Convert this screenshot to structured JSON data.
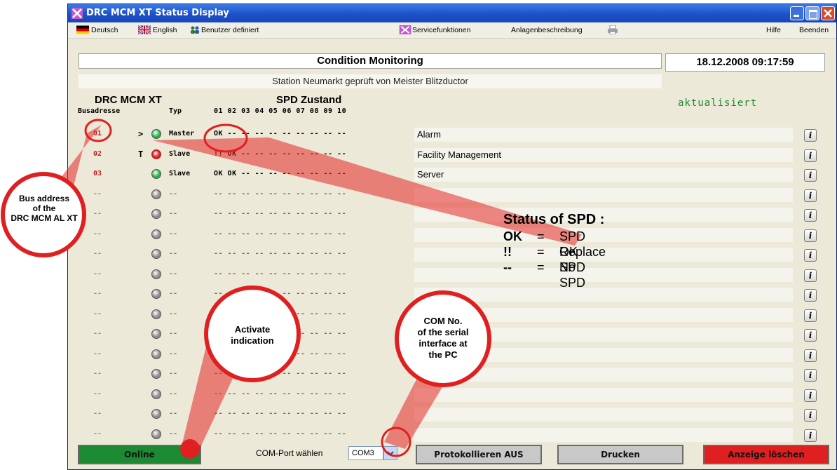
{
  "window": {
    "title": "DRC MCM XT Status Display"
  },
  "menu": {
    "deutsch": "Deutsch",
    "english": "English",
    "benutzer": "Benutzer definiert",
    "service": "Servicefunktionen",
    "anlagen": "Anlagenbeschreibung",
    "hilfe": "Hilfe",
    "beenden": "Beenden"
  },
  "header": {
    "title": "Condition Monitoring",
    "datetime": "18.12.2008  09:17:59",
    "subtitle": "Station Neumarkt geprüft von Meister Blitzductor",
    "status": "aktualisiert"
  },
  "columns": {
    "device": "DRC MCM XT",
    "spd": "SPD Zustand",
    "busadresse": "Busadresse",
    "typ": "Typ",
    "slots": "01 02 03 04 05 06 07 08 09 10"
  },
  "rows": [
    {
      "addr": "01",
      "mark": ">",
      "led": "green",
      "typ": "Master",
      "slots": "OK -- -- -- -- -- -- -- -- --",
      "desc": "Alarm"
    },
    {
      "addr": "02",
      "mark": "T",
      "led": "red",
      "typ": "Slave",
      "slots": "!! OK -- -- -- -- -- -- -- --",
      "desc": "Facility Management"
    },
    {
      "addr": "03",
      "mark": "",
      "led": "green",
      "typ": "Slave",
      "slots": "OK OK -- -- -- -- -- -- -- --",
      "desc": "Server"
    },
    {
      "addr": "--",
      "mark": "",
      "led": "grey",
      "typ": "--",
      "slots": "-- -- -- -- -- -- -- -- -- --",
      "desc": ""
    },
    {
      "addr": "--",
      "mark": "",
      "led": "grey",
      "typ": "--",
      "slots": "-- -- -- -- -- -- -- -- -- --",
      "desc": ""
    },
    {
      "addr": "--",
      "mark": "",
      "led": "grey",
      "typ": "--",
      "slots": "-- -- -- -- -- -- -- -- -- --",
      "desc": ""
    },
    {
      "addr": "--",
      "mark": "",
      "led": "grey",
      "typ": "--",
      "slots": "-- -- -- -- -- -- -- -- -- --",
      "desc": ""
    },
    {
      "addr": "--",
      "mark": "",
      "led": "grey",
      "typ": "--",
      "slots": "-- -- -- -- -- -- -- -- -- --",
      "desc": ""
    },
    {
      "addr": "--",
      "mark": "",
      "led": "grey",
      "typ": "--",
      "slots": "-- -- -- -- -- -- -- -- -- --",
      "desc": ""
    },
    {
      "addr": "--",
      "mark": "",
      "led": "grey",
      "typ": "--",
      "slots": "-- -- -- -- -- -- -- -- -- --",
      "desc": ""
    },
    {
      "addr": "--",
      "mark": "",
      "led": "grey",
      "typ": "--",
      "slots": "-- -- -- -- -- -- -- -- -- --",
      "desc": ""
    },
    {
      "addr": "--",
      "mark": "",
      "led": "grey",
      "typ": "--",
      "slots": "-- -- -- -- -- -- -- -- -- --",
      "desc": ""
    },
    {
      "addr": "--",
      "mark": "",
      "led": "grey",
      "typ": "--",
      "slots": "-- -- -- -- -- -- -- -- -- --",
      "desc": ""
    },
    {
      "addr": "--",
      "mark": "",
      "led": "grey",
      "typ": "--",
      "slots": "-- -- -- -- -- -- -- -- -- --",
      "desc": ""
    },
    {
      "addr": "--",
      "mark": "",
      "led": "grey",
      "typ": "--",
      "slots": "-- -- -- -- -- -- -- -- -- --",
      "desc": ""
    },
    {
      "addr": "--",
      "mark": "",
      "led": "grey",
      "typ": "--",
      "slots": "-- -- -- -- -- -- -- -- -- --",
      "desc": ""
    }
  ],
  "info_label": "i",
  "bottom": {
    "online": "Online",
    "com_label": "COM-Port wählen",
    "com_value": "COM3",
    "protokoll": "Protokollieren AUS",
    "drucken": "Drucken",
    "anzeige": "Anzeige löschen"
  },
  "annotations": {
    "bus_l1": "Bus address",
    "bus_l2": "of the",
    "bus_l3": "DRC MCM AL XT",
    "act_l1": "Activate",
    "act_l2": "indication",
    "com_l1": "COM No.",
    "com_l2": "of the serial",
    "com_l3": "interface at",
    "com_l4": "the PC",
    "legend_title": "Status of SPD :",
    "legend": [
      {
        "sym": "OK",
        "eq": "=",
        "text": "SPD OK"
      },
      {
        "sym": "!!",
        "eq": "=",
        "text": "Replace SPD"
      },
      {
        "sym": "--",
        "eq": "=",
        "text": "No SPD"
      }
    ]
  },
  "colors": {
    "online": "#1b8a33",
    "anzeige": "#e02020",
    "led_green": "#22b34a",
    "led_red": "#e03030",
    "led_grey": "#8c8c8c",
    "callout": "#e02020"
  }
}
